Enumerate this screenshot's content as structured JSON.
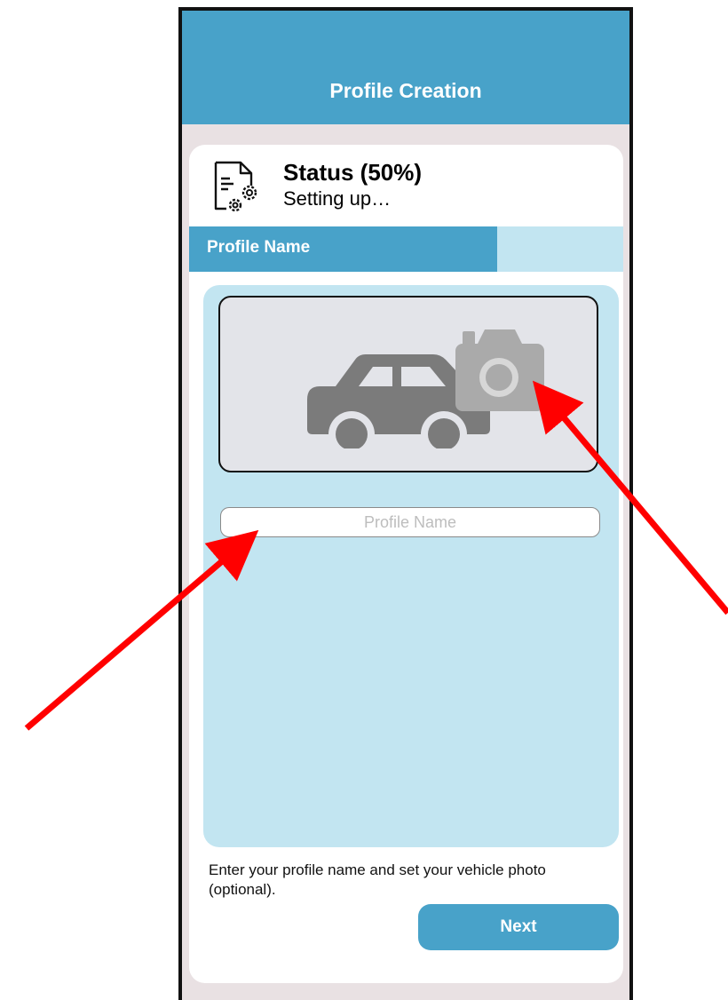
{
  "header": {
    "title": "Profile Creation"
  },
  "status": {
    "title": "Status (50%)",
    "subtitle": "Setting up…",
    "icon": "document-gear-icon"
  },
  "progress": {
    "label": "Profile Name",
    "fill_fraction": 0.71
  },
  "photo": {
    "icons": [
      "car-icon",
      "camera-icon"
    ]
  },
  "profile_name_input": {
    "placeholder": "Profile Name",
    "value": ""
  },
  "instructions": "Enter your profile name and set your vehicle photo (optional).",
  "next_button": {
    "label": "Next"
  },
  "colors": {
    "accent": "#48a2c9",
    "light_accent": "#c2e5f1",
    "background": "#e9e1e3",
    "annotation_arrow": "#ff0000"
  }
}
